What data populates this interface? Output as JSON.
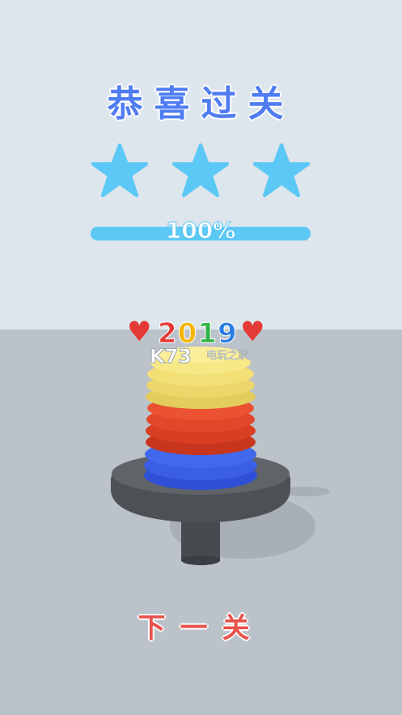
{
  "level_complete": {
    "title": "恭喜过关",
    "stars_earned": 3,
    "stars_total": 3,
    "star_color": "#5cc8f5",
    "progress_value": 1.0,
    "progress_label": "100%",
    "progress_color": "#5cc8f5"
  },
  "watermark": {
    "year": "2019",
    "logo": "K73",
    "site": "电玩之家",
    "heart_icon": "heart-icon"
  },
  "scene": {
    "object": "stacked-rings-tower",
    "ring_colors": [
      "#f4e07a",
      "#e84a2e",
      "#3d63e8"
    ],
    "base_color": "#55595f"
  },
  "actions": {
    "next_label": "下一关"
  }
}
